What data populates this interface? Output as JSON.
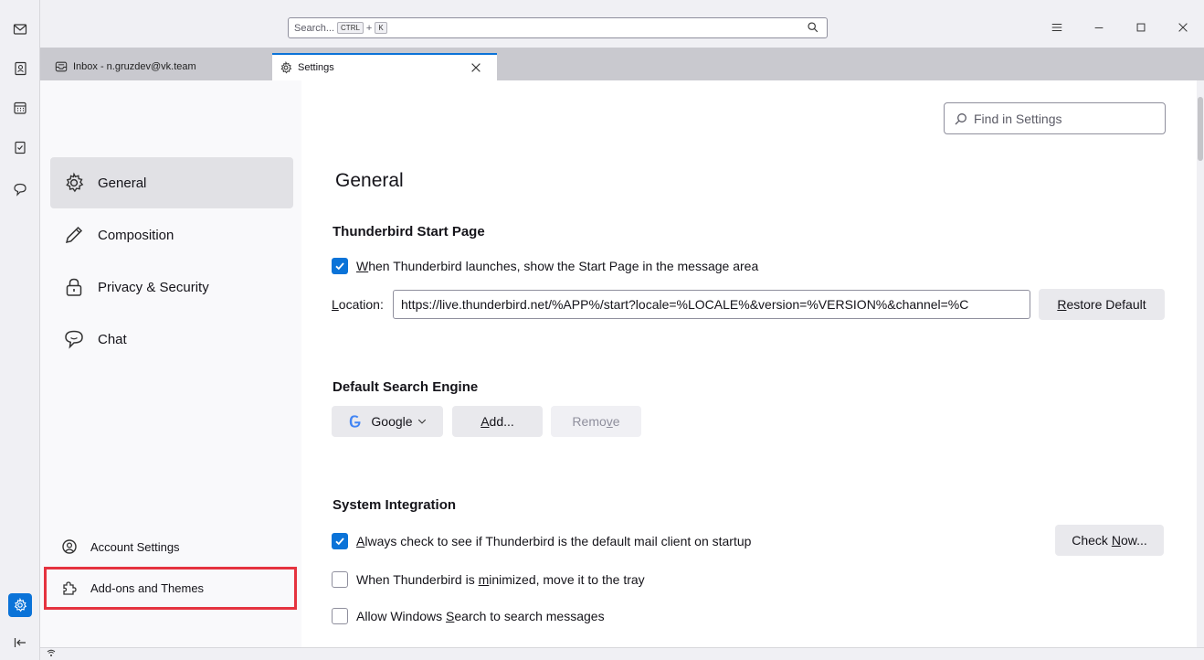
{
  "search": {
    "placeholder": "Search...",
    "key1": "CTRL",
    "plus": "+",
    "key2": "K"
  },
  "tabs": [
    {
      "label": "Inbox - n.gruzdev@vk.team"
    },
    {
      "label": "Settings"
    }
  ],
  "nav": {
    "items": [
      {
        "label": "General"
      },
      {
        "label": "Composition"
      },
      {
        "label": "Privacy & Security"
      },
      {
        "label": "Chat"
      }
    ],
    "account_settings": "Account Settings",
    "addons": "Add-ons and Themes"
  },
  "find": {
    "placeholder": "Find in Settings"
  },
  "general": {
    "title": "General",
    "start_page": {
      "heading": "Thunderbird Start Page",
      "check_first": "W",
      "check_rest": "hen Thunderbird launches, show the Start Page in the message area",
      "location_pre": "L",
      "location_rest": "ocation:",
      "location_value": "https://live.thunderbird.net/%APP%/start?locale=%LOCALE%&version=%VERSION%&channel=%C",
      "restore_first": "R",
      "restore_rest": "estore Default"
    },
    "search_engine": {
      "heading": "Default Search Engine",
      "engine": "Google",
      "add_first": "A",
      "add_rest": "dd...",
      "remove_pre": "Remo",
      "remove_u": "v",
      "remove_post": "e"
    },
    "system": {
      "heading": "System Integration",
      "check1_first": "A",
      "check1_rest": "lways check to see if Thunderbird is the default mail client on startup",
      "check_now_pre": "Check ",
      "check_now_u": "N",
      "check_now_post": "ow...",
      "check2_pre": "When Thunderbird is ",
      "check2_u": "m",
      "check2_post": "inimized, move it to the tray",
      "check3_pre": "Allow Windows ",
      "check3_u": "S",
      "check3_post": "earch to search messages"
    }
  },
  "colors": {
    "accent": "#0b73d8",
    "highlight": "#e5333f"
  }
}
